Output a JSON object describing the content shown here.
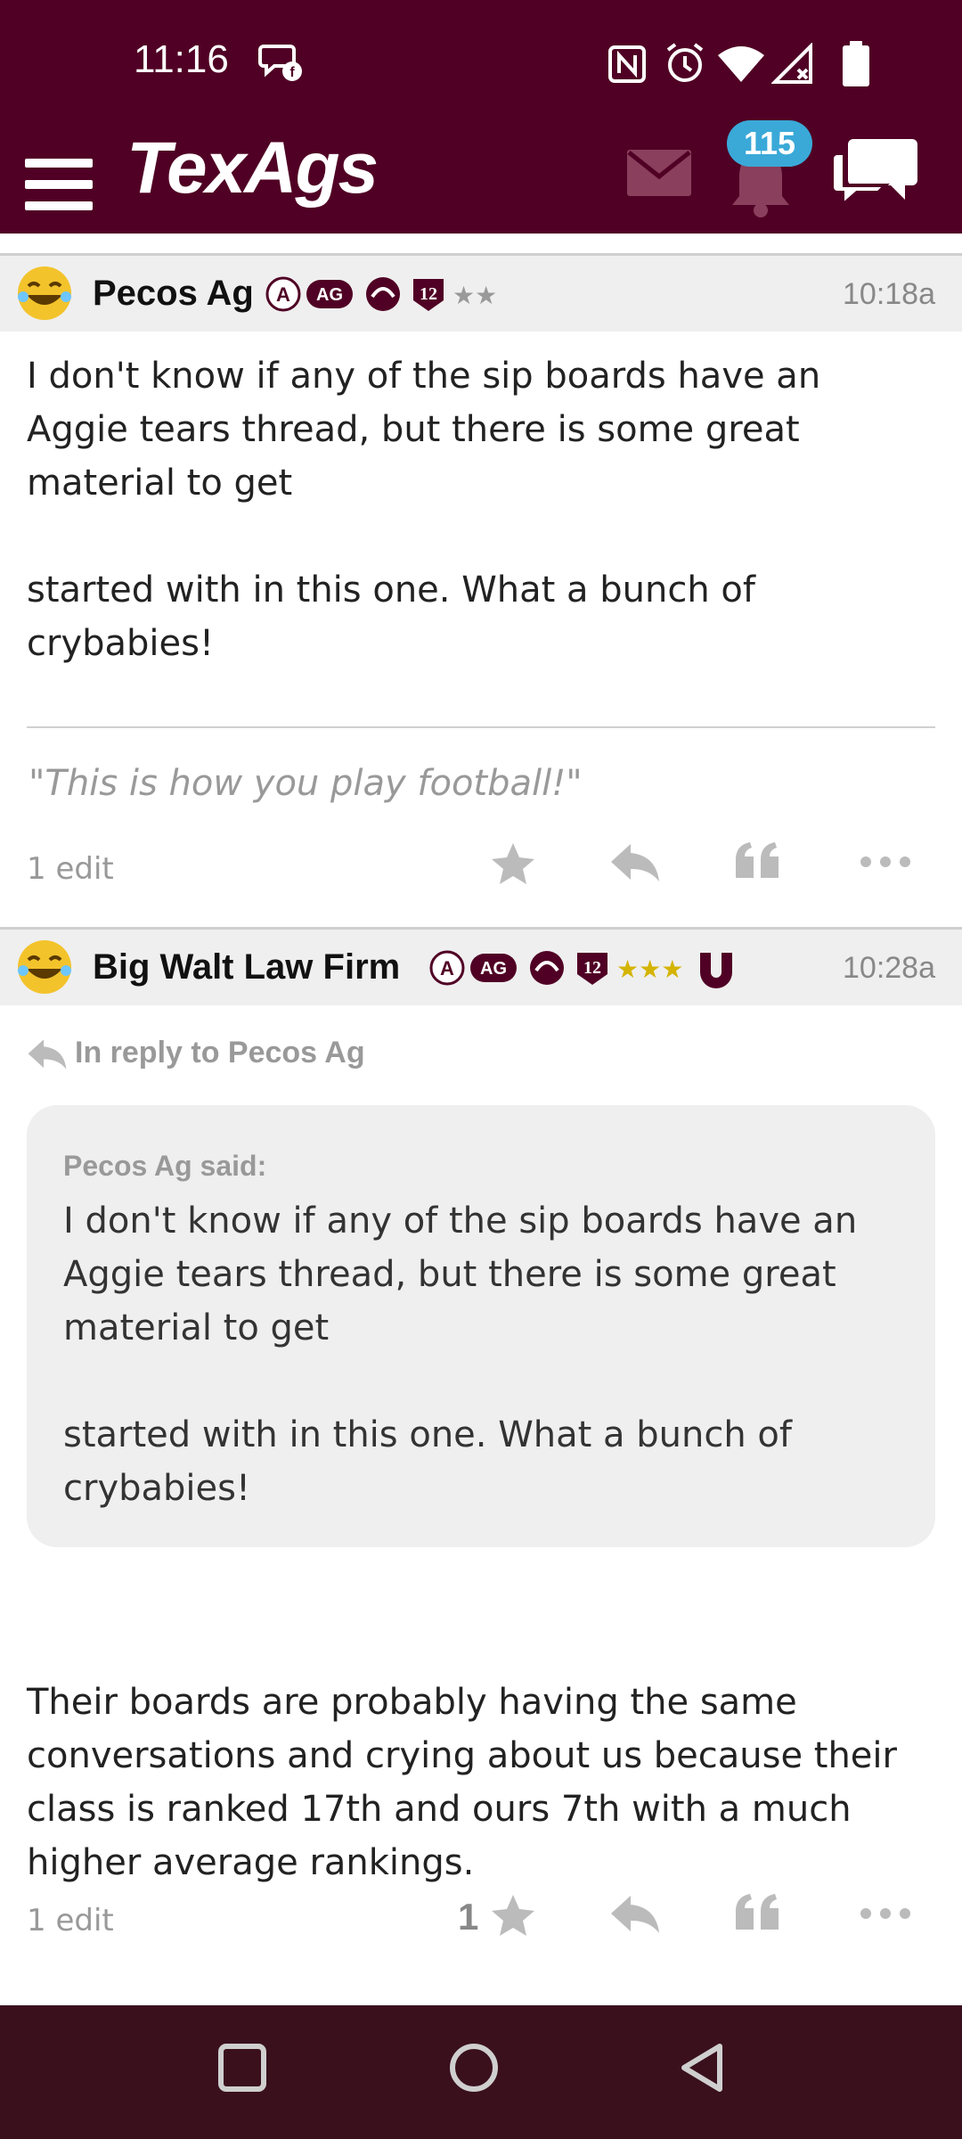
{
  "status_bar": {
    "time": "11:16"
  },
  "app_bar": {
    "logo": "TexAgs",
    "notifications_count": "115"
  },
  "posts": [
    {
      "author": "Pecos Ag",
      "time": "10:18a",
      "body_lines": [
        "I don't know if any of the sip boards have an",
        "Aggie tears thread, but there is some great",
        "material to get",
        "",
        "started with in this one. What a bunch of",
        "crybabies!"
      ],
      "signature": "\"This is how you play football!\"",
      "edits": "1 edit",
      "stars": "★★",
      "like_count": ""
    },
    {
      "author": "Big Walt Law Firm",
      "time": "10:28a",
      "in_reply_to": "In reply to Pecos Ag",
      "quote": {
        "who": "Pecos Ag said:",
        "lines": [
          "I don't know if any of the sip boards have an",
          "Aggie tears thread, but there is some great",
          "material to get",
          "",
          "started with in this one. What a bunch of",
          "crybabies!"
        ]
      },
      "body_lines": [
        "Their boards are probably having the same",
        "conversations and crying about us because their",
        "class is ranked 17th and ours 7th with a much",
        "higher average rankings."
      ],
      "edits": "1 edit",
      "stars": "★★★",
      "like_count": "1"
    }
  ],
  "colors": {
    "brand": "#500024",
    "badge_blue": "#3aa9d8",
    "header_gray": "#efefef",
    "nav_bg": "#3a101d"
  },
  "icons": {
    "status": [
      "chat-bubble-notification-icon",
      "nfc-icon",
      "alarm-icon",
      "wifi-icon",
      "signal-icon",
      "battery-icon"
    ],
    "toolbar": [
      "menu-icon",
      "mail-icon",
      "bell-icon",
      "chat-icon"
    ],
    "actions": [
      "star-icon",
      "reply-icon",
      "quote-icon",
      "more-icon"
    ],
    "nav": [
      "recent-apps-icon",
      "home-icon",
      "back-icon"
    ]
  }
}
